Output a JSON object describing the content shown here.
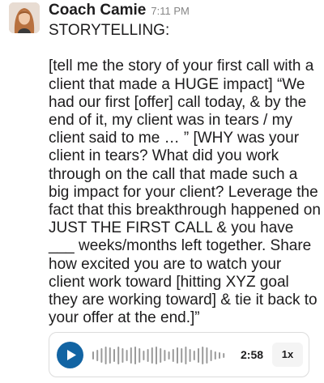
{
  "message": {
    "sender": "Coach Camie",
    "time": "7:11 PM",
    "text": "STORYTELLING:\n\n[tell me the story of your first call with a client that made a HUGE impact] “We had our first [offer] call today, & by the end of it, my client was in tears / my client said to me … ” [WHY was your client in tears? What did you work through on the call that made such a big impact for your client? Leverage the fact that this breakthrough happened on JUST THE FIRST CALL & you have ___ weeks/months left together. Share how excited you are to watch your client work toward [hitting XYZ goal they are working toward] & tie it back to your offer at the end.]”"
  },
  "audio": {
    "play_icon": "play-icon",
    "duration": "2:58",
    "speed": "1x",
    "progress": 0,
    "accent_color": "#1264a3"
  }
}
